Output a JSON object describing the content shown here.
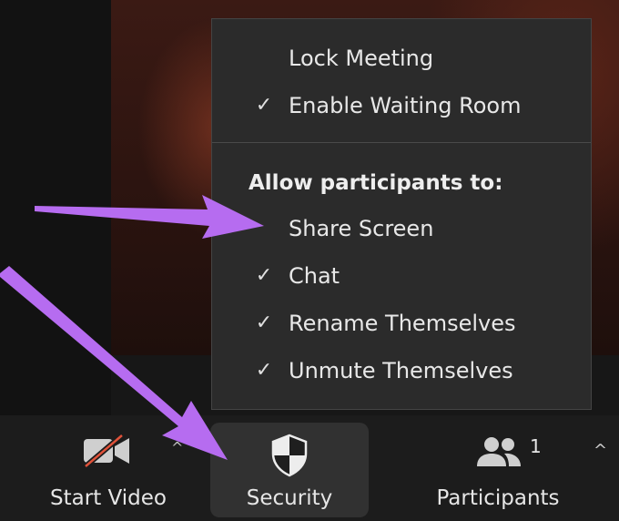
{
  "menu": {
    "items_top": [
      {
        "label": "Lock Meeting",
        "checked": false
      },
      {
        "label": "Enable Waiting Room",
        "checked": true
      }
    ],
    "section_header": "Allow participants to:",
    "items_allow": [
      {
        "label": "Share Screen",
        "checked": false
      },
      {
        "label": "Chat",
        "checked": true
      },
      {
        "label": "Rename Themselves",
        "checked": true
      },
      {
        "label": "Unmute Themselves",
        "checked": true
      }
    ],
    "check_glyph": "✓"
  },
  "toolbar": {
    "start_video_label": "Start Video",
    "security_label": "Security",
    "participants_label": "Participants",
    "participants_count": "1"
  },
  "colors": {
    "menu_bg": "#2b2b2b",
    "toolbar_bg": "#1c1c1c",
    "accent_arrow": "#b66cf0",
    "video_off_slash": "#e0523a"
  },
  "icons": {
    "video_off": "video-camera-slash-icon",
    "security": "shield-icon",
    "participants": "people-icon",
    "caret": "chevron-up-icon"
  }
}
